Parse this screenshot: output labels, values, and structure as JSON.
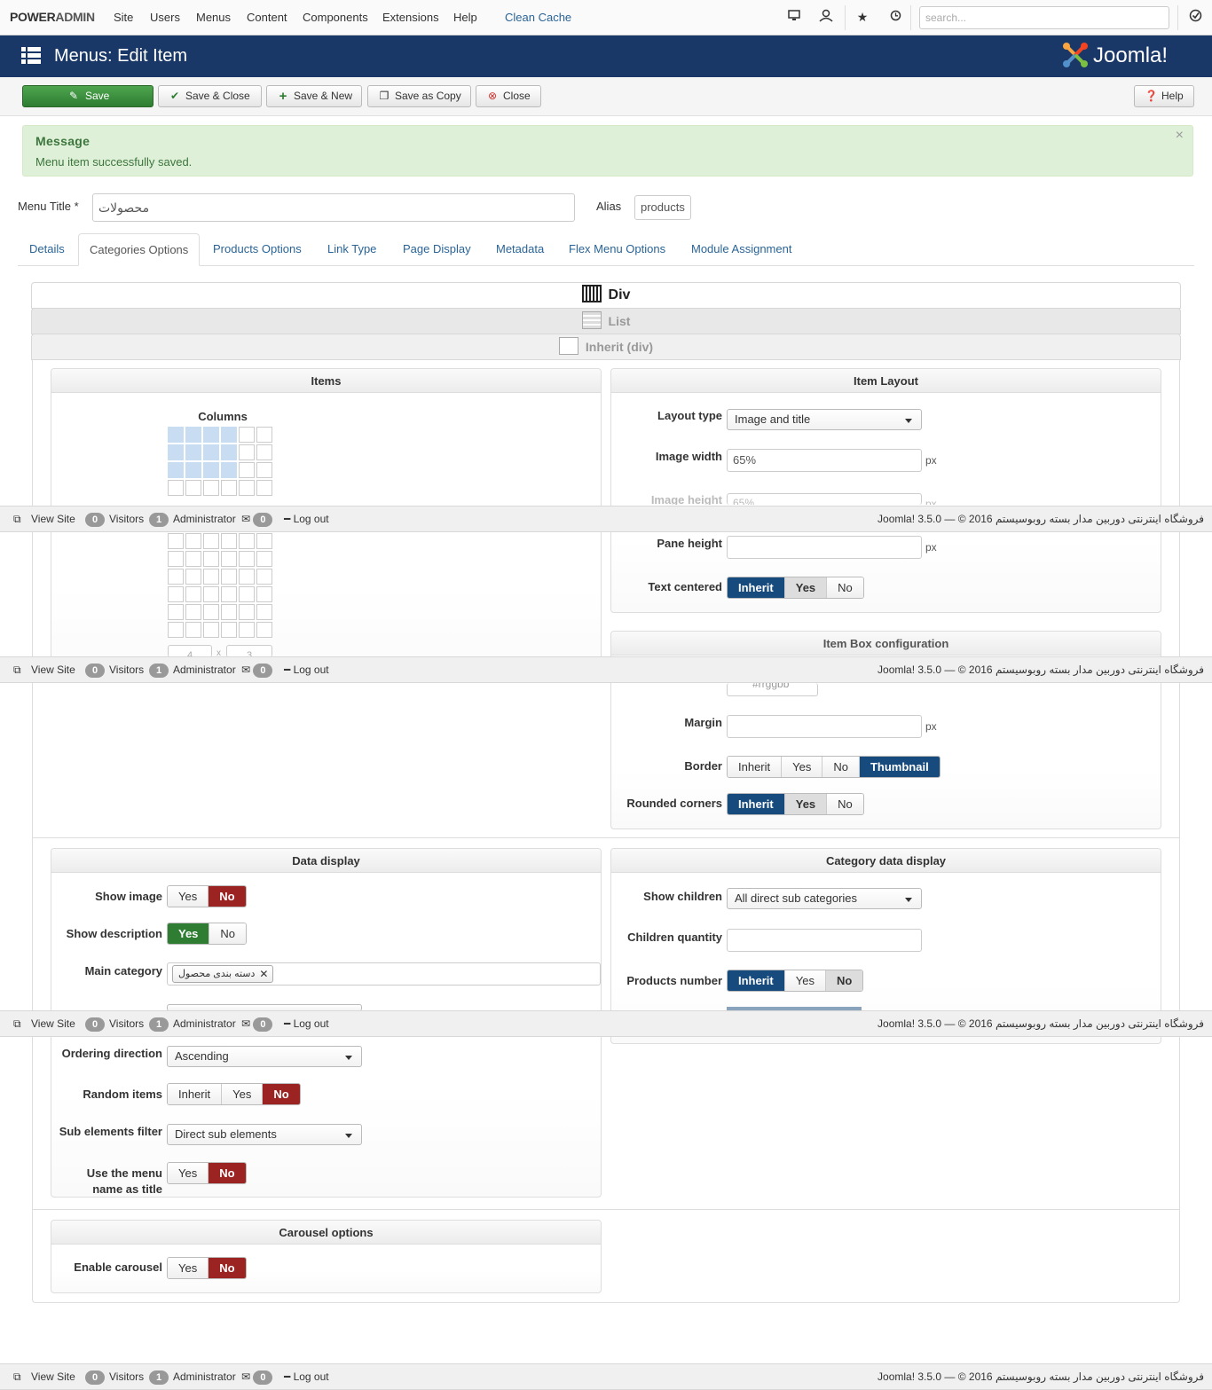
{
  "nav": {
    "brand_a": "POWER",
    "brand_b": "ADMIN",
    "items": [
      "Site",
      "Users",
      "Menus",
      "Content",
      "Components",
      "Extensions",
      "Help"
    ],
    "clean_cache": "Clean Cache",
    "search_placeholder": "search..."
  },
  "header": {
    "title": "Menus: Edit Item",
    "logo_text": "Joomla!"
  },
  "toolbar": {
    "save": "Save",
    "save_close": "Save & Close",
    "save_new": "Save & New",
    "save_copy": "Save as Copy",
    "close": "Close",
    "help": "Help"
  },
  "message": {
    "heading": "Message",
    "text": "Menu item successfully saved.",
    "close": "×"
  },
  "form": {
    "title_label": "Menu Title *",
    "title_value": "محصولات",
    "alias_label": "Alias",
    "alias_value": "products"
  },
  "tabs": [
    "Details",
    "Categories Options",
    "Products Options",
    "Link Type",
    "Page Display",
    "Metadata",
    "Flex Menu Options",
    "Module Assignment"
  ],
  "strips": {
    "div": "Div",
    "list": "List",
    "inherit": "Inherit (div)"
  },
  "items_panel": {
    "title": "Items",
    "columns_label": "Columns",
    "cols_value": "4",
    "x": "x",
    "rows_value": "3"
  },
  "item_layout": {
    "title": "Item Layout",
    "layout_type_label": "Layout type",
    "layout_type_value": "Image and title",
    "image_width_label": "Image width",
    "image_width_value": "65%",
    "image_height_label": "Image height",
    "image_height_value": "65%",
    "px": "px",
    "pane_height_label": "Pane height",
    "text_centered_label": "Text centered",
    "opts_inherit": "Inherit",
    "opts_yes": "Yes",
    "opts_no": "No"
  },
  "item_box": {
    "title": "Item Box configuration",
    "color_value": "#rrggbb",
    "margin_label": "Margin",
    "border_label": "Border",
    "thumbnail": "Thumbnail",
    "rounded_label": "Rounded corners"
  },
  "data_display": {
    "title": "Data display",
    "show_image_label": "Show image",
    "show_description_label": "Show description",
    "main_category_label": "Main category",
    "main_category_tag": "دسته بندی محصول",
    "ordering_direction_label": "Ordering direction",
    "ordering_direction_value": "Ascending",
    "random_items_label": "Random items",
    "sub_filter_label": "Sub elements filter",
    "sub_filter_value": "Direct sub elements",
    "menu_name_label_1": "Use the menu",
    "menu_name_label_2": "name as title"
  },
  "category_display": {
    "title": "Category data display",
    "show_children_label": "Show children",
    "show_children_value": "All direct sub categories",
    "children_qty_label": "Children quantity",
    "products_number_label": "Products number"
  },
  "carousel": {
    "title": "Carousel options",
    "enable_label": "Enable carousel"
  },
  "status": {
    "view_site": "View Site",
    "visitors_count": "0",
    "visitors": "Visitors",
    "admin_count": "1",
    "admin": "Administrator",
    "msg_count": "0",
    "logout": "Log out",
    "right": "Joomla! 3.5.0 — © 2016 فروشگاه اینترنتی دوربین مدار بسته روبوسیستم"
  },
  "colors": {
    "header": "#1a3867",
    "active_blue": "#174a7d",
    "no_red": "#9b2423",
    "yes_green": "#2e7d32",
    "message_bg": "#dff0d8"
  }
}
